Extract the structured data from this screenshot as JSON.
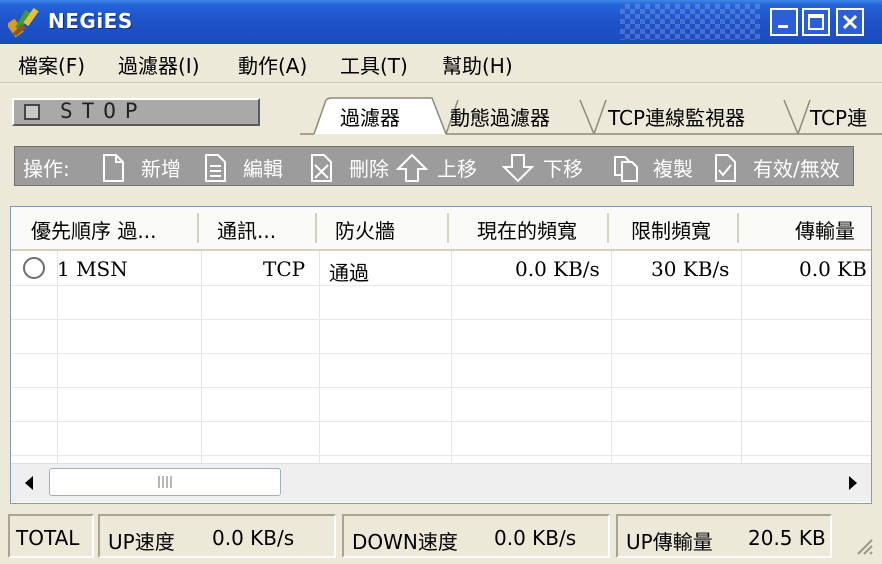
{
  "window": {
    "title": "NEGiES"
  },
  "menu": [
    "檔案(F)",
    "過濾器(I)",
    "動作(A)",
    "工具(T)",
    "幫助(H)"
  ],
  "stop_button": {
    "label": "STOP"
  },
  "tabs": [
    "過濾器",
    "動態過濾器",
    "TCP連線監視器",
    "TCP連"
  ],
  "operations": {
    "label": "操作:",
    "buttons": [
      "新增",
      "編輯",
      "刪除",
      "上移",
      "下移",
      "複製",
      "有效/無效"
    ]
  },
  "table": {
    "columns": [
      "優先順序 過...",
      "通訊...",
      "防火牆",
      "現在的頻寬",
      "限制頻寬",
      "傳輸量"
    ],
    "rows": [
      {
        "priority_name": "1 MSN",
        "protocol": "TCP",
        "firewall": "通過",
        "current_bw": "0.0 KB/s",
        "limit_bw": "30 KB/s",
        "transfer": "0.0 KB"
      }
    ]
  },
  "status": {
    "total_label": "TOTAL",
    "up_speed_label": "UP速度",
    "up_speed_value": "0.0 KB/s",
    "down_speed_label": "DOWN速度",
    "down_speed_value": "0.0 KB/s",
    "up_transfer_label": "UP傳輸量",
    "up_transfer_value": "20.5 KB"
  },
  "icons": {
    "app": "brush-icon",
    "minimize": "minimize-icon",
    "maximize": "maximize-icon",
    "close": "close-icon",
    "add": "new-document-icon",
    "edit": "edit-document-icon",
    "delete": "delete-document-icon",
    "up": "arrow-up-icon",
    "down": "arrow-down-icon",
    "copy": "copy-icon",
    "toggle": "check-document-icon"
  },
  "colors": {
    "titlebar": "#1e52c8",
    "toolbar": "#9c9c9c",
    "chrome": "#ece9d8"
  }
}
